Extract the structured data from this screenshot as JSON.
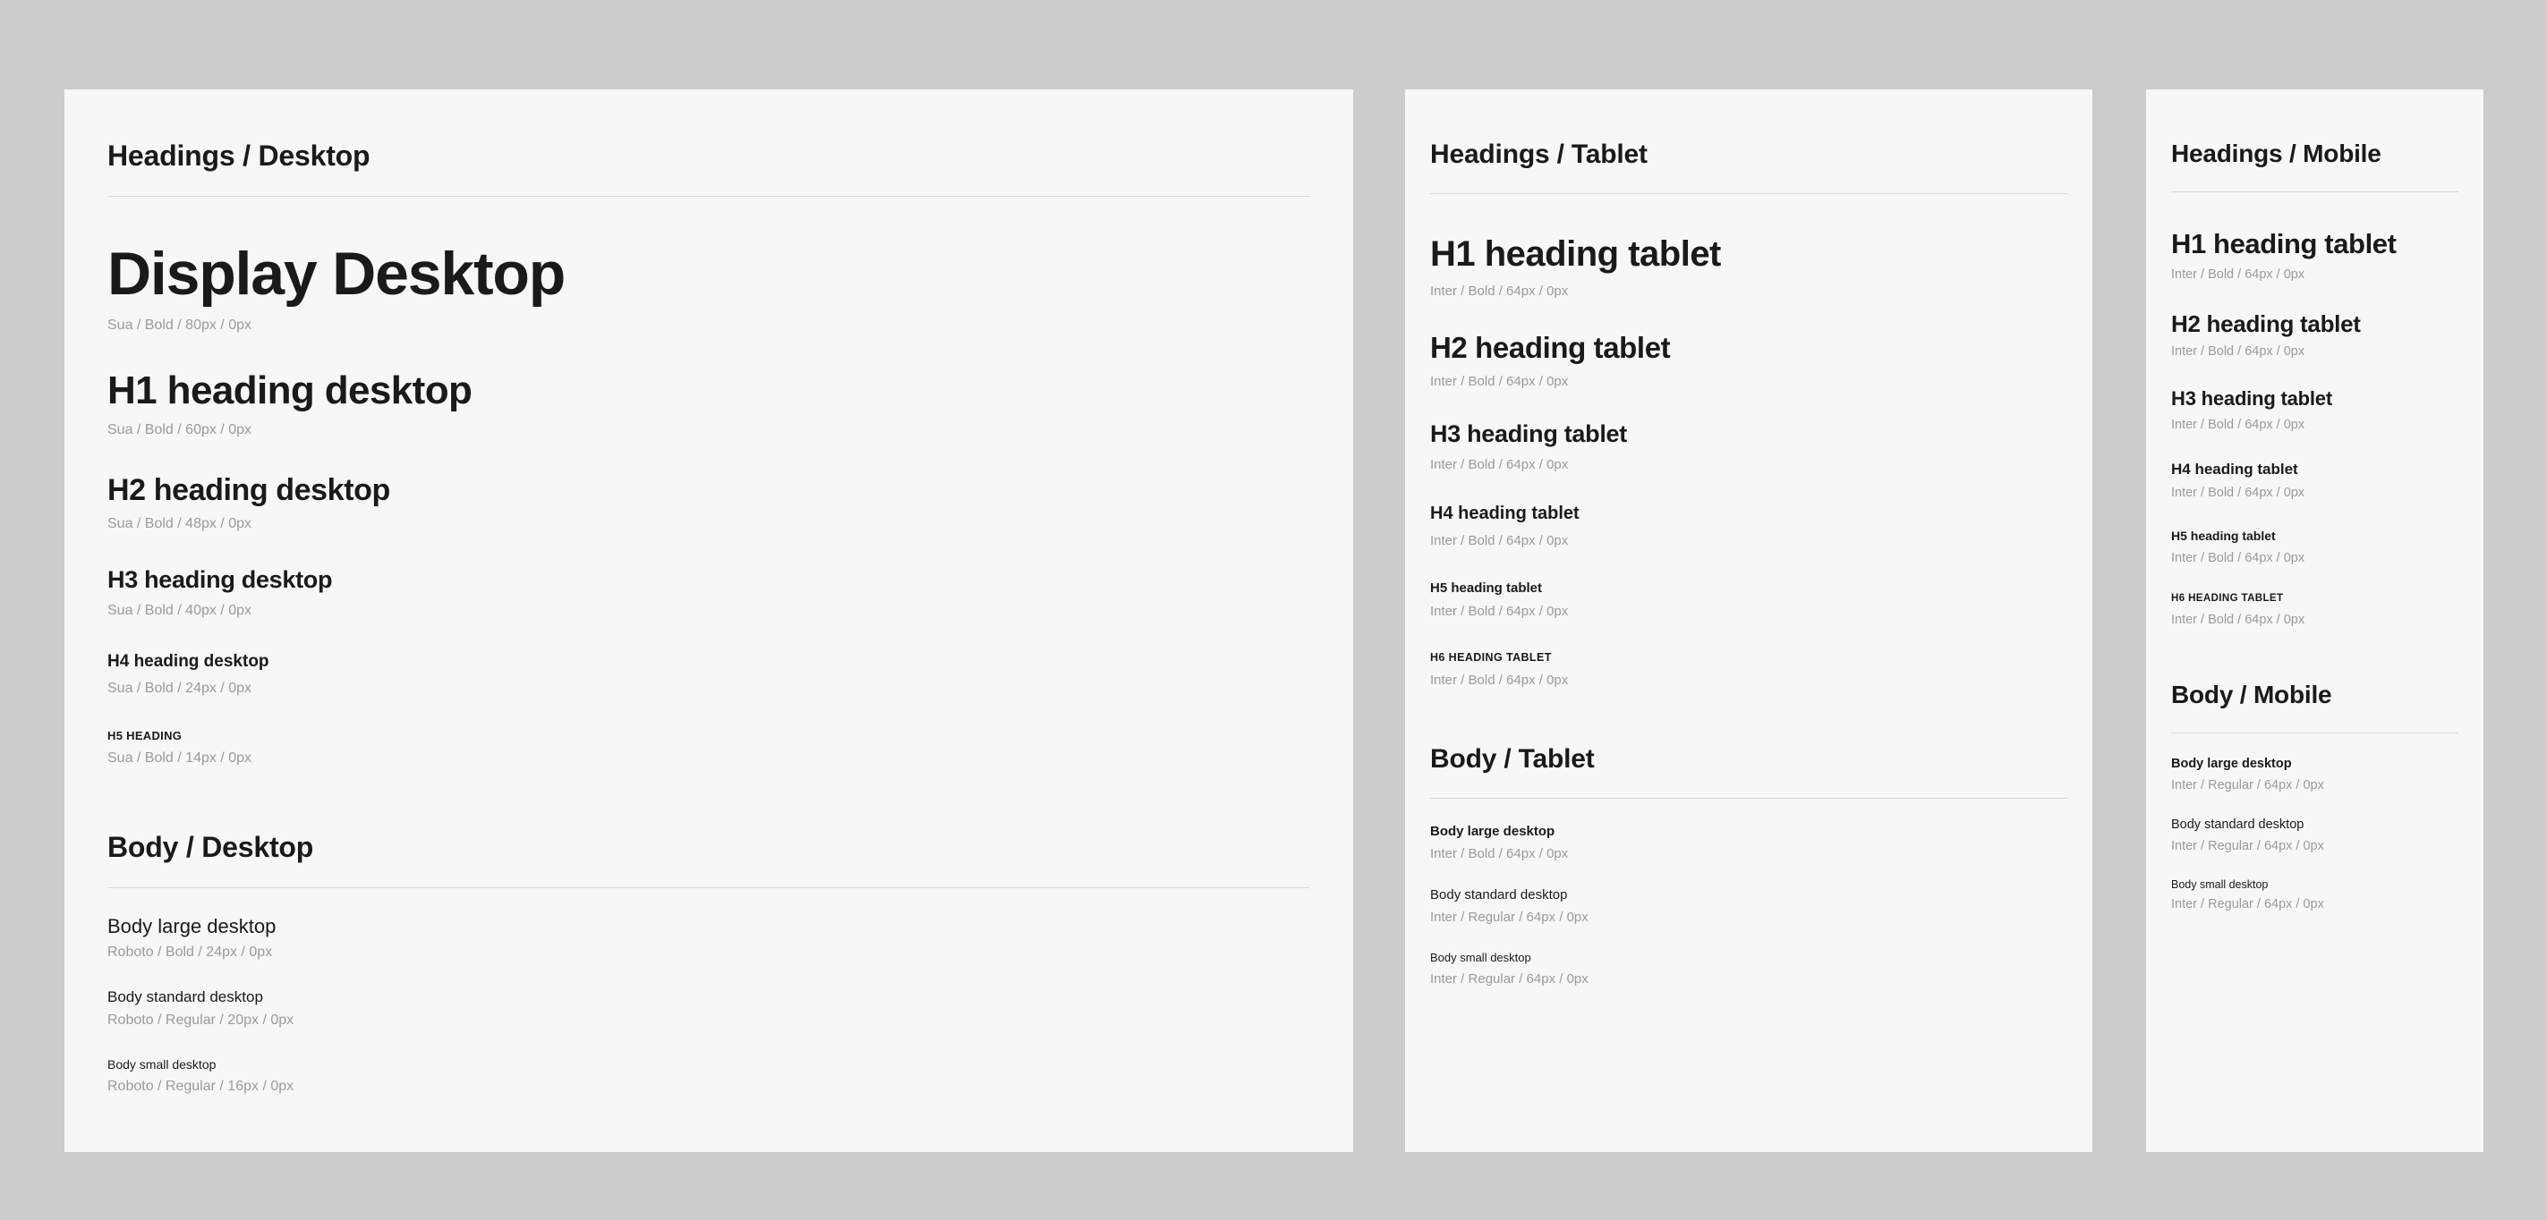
{
  "background_color": "#cccccc",
  "panel_color": "#f7f7f7",
  "text_color": "#1a1a1a",
  "spec_color": "#9a9a9a",
  "rule_color": "#d8d8d8",
  "desktop": {
    "headings_title": "Headings / Desktop",
    "body_title": "Body / Desktop",
    "headings": [
      {
        "sample": "Display Desktop",
        "spec": "Sua / Bold / 80px / 0px"
      },
      {
        "sample": "H1 heading desktop",
        "spec": "Sua / Bold / 60px / 0px"
      },
      {
        "sample": "H2 heading desktop",
        "spec": "Sua / Bold / 48px / 0px"
      },
      {
        "sample": "H3 heading desktop",
        "spec": "Sua / Bold / 40px / 0px"
      },
      {
        "sample": "H4 heading desktop",
        "spec": "Sua / Bold / 24px / 0px"
      },
      {
        "sample": "H5 HEADING",
        "spec": "Sua / Bold / 14px / 0px"
      }
    ],
    "body": [
      {
        "sample": "Body large desktop",
        "spec": "Roboto / Bold / 24px / 0px"
      },
      {
        "sample": "Body standard desktop",
        "spec": "Roboto / Regular / 20px / 0px"
      },
      {
        "sample": "Body small desktop",
        "spec": "Roboto / Regular / 16px / 0px"
      }
    ]
  },
  "tablet": {
    "headings_title": "Headings / Tablet",
    "body_title": "Body / Tablet",
    "headings": [
      {
        "sample": "H1 heading tablet",
        "spec": "Inter / Bold / 64px / 0px"
      },
      {
        "sample": "H2 heading tablet",
        "spec": "Inter / Bold / 64px / 0px"
      },
      {
        "sample": "H3 heading tablet",
        "spec": "Inter / Bold / 64px / 0px"
      },
      {
        "sample": "H4 heading tablet",
        "spec": "Inter / Bold / 64px / 0px"
      },
      {
        "sample": "H5 heading tablet",
        "spec": "Inter / Bold / 64px / 0px"
      },
      {
        "sample": "H6 HEADING TABLET",
        "spec": "Inter / Bold / 64px / 0px"
      }
    ],
    "body": [
      {
        "sample": "Body large desktop",
        "spec": "Inter / Bold / 64px / 0px"
      },
      {
        "sample": "Body standard desktop",
        "spec": "Inter / Regular / 64px / 0px"
      },
      {
        "sample": "Body small desktop",
        "spec": "Inter / Regular / 64px / 0px"
      }
    ]
  },
  "mobile": {
    "headings_title": "Headings / Mobile",
    "body_title": "Body / Mobile",
    "headings": [
      {
        "sample": "H1 heading tablet",
        "spec": "Inter / Bold / 64px / 0px"
      },
      {
        "sample": "H2 heading tablet",
        "spec": "Inter / Bold / 64px / 0px"
      },
      {
        "sample": "H3 heading tablet",
        "spec": "Inter / Bold / 64px / 0px"
      },
      {
        "sample": "H4 heading tablet",
        "spec": "Inter / Bold / 64px / 0px"
      },
      {
        "sample": "H5 heading tablet",
        "spec": "Inter / Bold / 64px / 0px"
      },
      {
        "sample": "H6 HEADING TABLET",
        "spec": "Inter / Bold / 64px / 0px"
      }
    ],
    "body": [
      {
        "sample": "Body large desktop",
        "spec": "Inter / Regular / 64px / 0px"
      },
      {
        "sample": "Body standard desktop",
        "spec": "Inter / Regular / 64px / 0px"
      },
      {
        "sample": "Body small desktop",
        "spec": "Inter / Regular / 64px / 0px"
      }
    ]
  }
}
